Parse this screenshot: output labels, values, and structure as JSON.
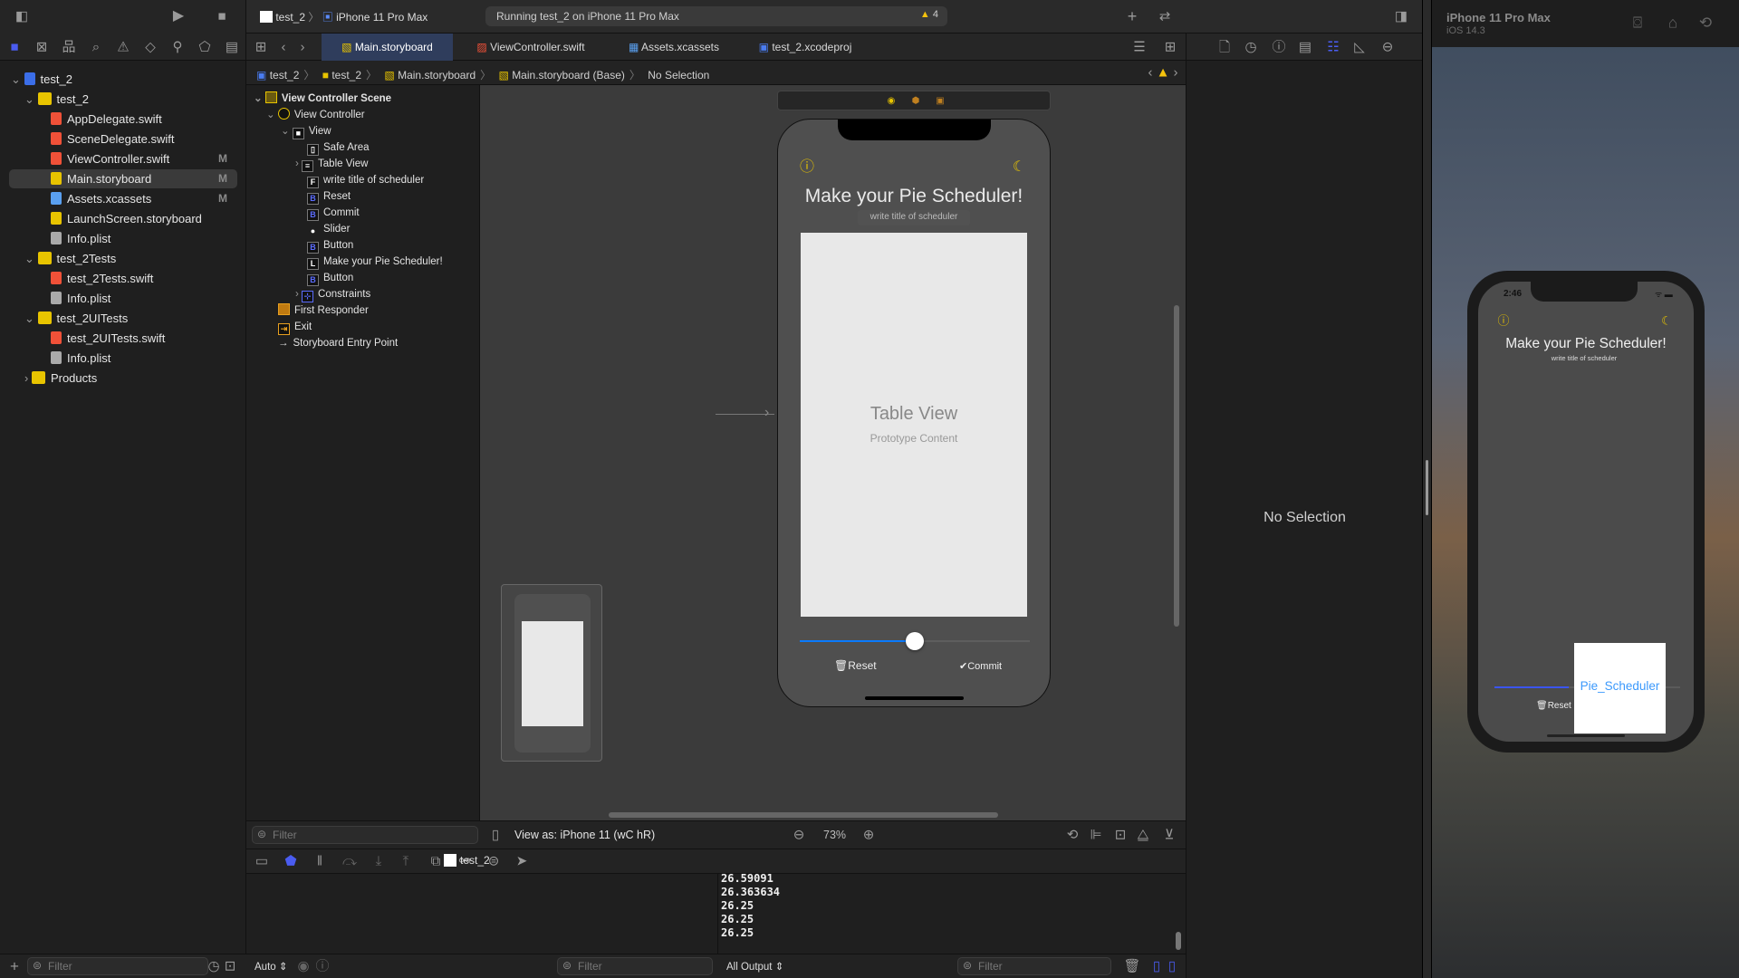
{
  "toolbar": {
    "scheme": "test_2",
    "device": "iPhone 11 Pro Max",
    "status": "Running test_2 on iPhone 11 Pro Max",
    "warning_count": "4"
  },
  "tabs": [
    {
      "label": "Main.storyboard",
      "selected": true
    },
    {
      "label": "ViewController.swift"
    },
    {
      "label": "Assets.xcassets"
    },
    {
      "label": "test_2.xcodeproj"
    }
  ],
  "navigator": {
    "items": [
      {
        "label": "test_2",
        "type": "project",
        "level": 0
      },
      {
        "label": "test_2",
        "type": "folder",
        "level": 1
      },
      {
        "label": "AppDelegate.swift",
        "type": "swift",
        "level": 2
      },
      {
        "label": "SceneDelegate.swift",
        "type": "swift",
        "level": 2
      },
      {
        "label": "ViewController.swift",
        "type": "swift",
        "level": 2,
        "badge": "M"
      },
      {
        "label": "Main.storyboard",
        "type": "storyboard",
        "level": 2,
        "badge": "M",
        "selected": true
      },
      {
        "label": "Assets.xcassets",
        "type": "assets",
        "level": 2,
        "badge": "M"
      },
      {
        "label": "LaunchScreen.storyboard",
        "type": "storyboard",
        "level": 2
      },
      {
        "label": "Info.plist",
        "type": "plist",
        "level": 2
      },
      {
        "label": "test_2Tests",
        "type": "folder",
        "level": 1
      },
      {
        "label": "test_2Tests.swift",
        "type": "swift",
        "level": 2
      },
      {
        "label": "Info.plist",
        "type": "plist",
        "level": 2
      },
      {
        "label": "test_2UITests",
        "type": "folder",
        "level": 1
      },
      {
        "label": "test_2UITests.swift",
        "type": "swift",
        "level": 2
      },
      {
        "label": "Info.plist",
        "type": "plist",
        "level": 2
      },
      {
        "label": "Products",
        "type": "folder",
        "level": 1,
        "collapsed": true
      }
    ],
    "filter_placeholder": "Filter"
  },
  "breadcrumb": [
    "test_2",
    "test_2",
    "Main.storyboard",
    "Main.storyboard (Base)",
    "No Selection"
  ],
  "outline": {
    "items": [
      {
        "label": "View Controller Scene",
        "level": 0,
        "badge": "scene",
        "bold": true
      },
      {
        "label": "View Controller",
        "level": 1,
        "badge": "vc"
      },
      {
        "label": "View",
        "level": 2,
        "badge": "■"
      },
      {
        "label": "Safe Area",
        "level": 3,
        "badge": "▯"
      },
      {
        "label": "Table View",
        "level": 3,
        "badge": "≡",
        "collapsed": true
      },
      {
        "label": "write title of scheduler",
        "level": 3,
        "badge": "F"
      },
      {
        "label": "Reset",
        "level": 3,
        "badge": "B"
      },
      {
        "label": "Commit",
        "level": 3,
        "badge": "B"
      },
      {
        "label": "Slider",
        "level": 3,
        "badge": "slider"
      },
      {
        "label": "Button",
        "level": 3,
        "badge": "B"
      },
      {
        "label": "Make your Pie Scheduler!",
        "level": 3,
        "badge": "L"
      },
      {
        "label": "Button",
        "level": 3,
        "badge": "B"
      },
      {
        "label": "Constraints",
        "level": 3,
        "badge": "⊹",
        "collapsed": true
      },
      {
        "label": "First Responder",
        "level": 1,
        "badge": "fr"
      },
      {
        "label": "Exit",
        "level": 1,
        "badge": "exit"
      },
      {
        "label": "Storyboard Entry Point",
        "level": 1,
        "badge": "→"
      }
    ],
    "filter_placeholder": "Filter"
  },
  "canvas": {
    "title": "Make your Pie Scheduler!",
    "subtitle": "write title of scheduler",
    "table_title": "Table View",
    "table_sub": "Prototype Content",
    "slider_value": 0.5,
    "reset": "Reset",
    "commit": "Commit",
    "view_as": "View as: iPhone 11 (wC hR)",
    "view_as_w": "w",
    "view_as_h": "h",
    "zoom": "73%"
  },
  "debug": {
    "target": "test_2"
  },
  "console": {
    "lines": [
      "26.59091",
      "26.363634",
      "26.25",
      "26.25",
      "26.25"
    ],
    "auto": "Auto ⇕",
    "output": "All Output ⇕",
    "filter_placeholder": "Filter"
  },
  "inspector": {
    "empty": "No Selection"
  },
  "simulator": {
    "device": "iPhone 11 Pro Max",
    "os": "iOS 14.3",
    "time": "2:46",
    "title": "Make your Pie Scheduler!",
    "subtitle": "write title of scheduler",
    "reset": "Reset",
    "popup": "Pie_Scheduler",
    "slider_value": 0.4
  },
  "colors": {
    "accent": "#4a5cf0",
    "selected_tab": "#2f3d5c",
    "yellow": "#e8c400",
    "ios_blue": "#3b99fc"
  }
}
